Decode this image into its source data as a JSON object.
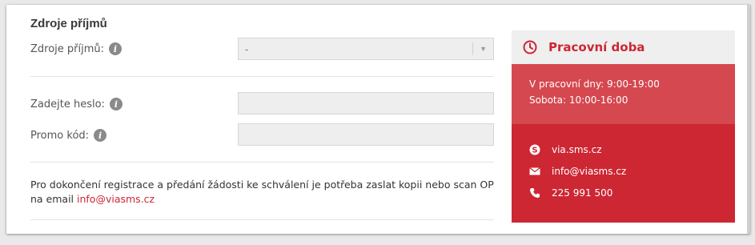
{
  "section": {
    "title": "Zdroje příjmů"
  },
  "form": {
    "income_source": {
      "label": "Zdroje příjmů:",
      "value": "-"
    },
    "password": {
      "label": "Zadejte heslo:",
      "value": ""
    },
    "promo": {
      "label": "Promo kód:",
      "value": ""
    }
  },
  "notice": {
    "text": "Pro dokončení registrace a předání žádosti ke schválení je potřeba zaslat kopii nebo scan OP na email ",
    "email": "info@viasms.cz"
  },
  "panel": {
    "title": "Pracovní doba",
    "hours": {
      "weekdays": "V pracovní dny: 9:00-19:00",
      "saturday": "Sobota: 10:00-16:00"
    },
    "contacts": {
      "skype": "via.sms.cz",
      "email": "info@viasms.cz",
      "phone": "225 991 500"
    }
  },
  "colors": {
    "accent": "#cc2733",
    "hours_bg": "#d5484f",
    "contacts_bg": "#cc2733"
  },
  "icons": {
    "info": "info-icon",
    "clock": "clock-icon",
    "skype": "skype-icon",
    "mail": "mail-icon",
    "phone": "phone-icon"
  }
}
